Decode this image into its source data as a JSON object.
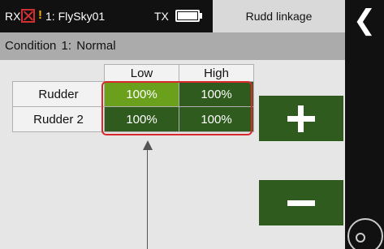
{
  "status_bar": {
    "rx_label": "RX",
    "rx_status_icon": "rx-signal-lost-icon",
    "warning_icon": "warning-icon",
    "model_name": "1: FlySky01",
    "tx_label": "TX",
    "tx_battery_level": 1.0,
    "menu_title": "Rudd linkage"
  },
  "condition": {
    "label": "Condition 1:",
    "value": "Normal"
  },
  "table": {
    "columns": [
      "Low",
      "High"
    ],
    "rows": [
      {
        "label": "Rudder",
        "low": "100%",
        "high": "100%"
      },
      {
        "label": "Rudder 2",
        "low": "100%",
        "high": "100%"
      }
    ]
  },
  "buttons": {
    "increase_icon": "plus-icon",
    "decrease_icon": "minus-icon",
    "back_icon": "chevron-left-icon",
    "roll_icon": "roll-icon"
  },
  "colors": {
    "selected_cell": "#6aa01c",
    "value_cell": "#2f5c1e",
    "highlight": "#d8282b"
  }
}
